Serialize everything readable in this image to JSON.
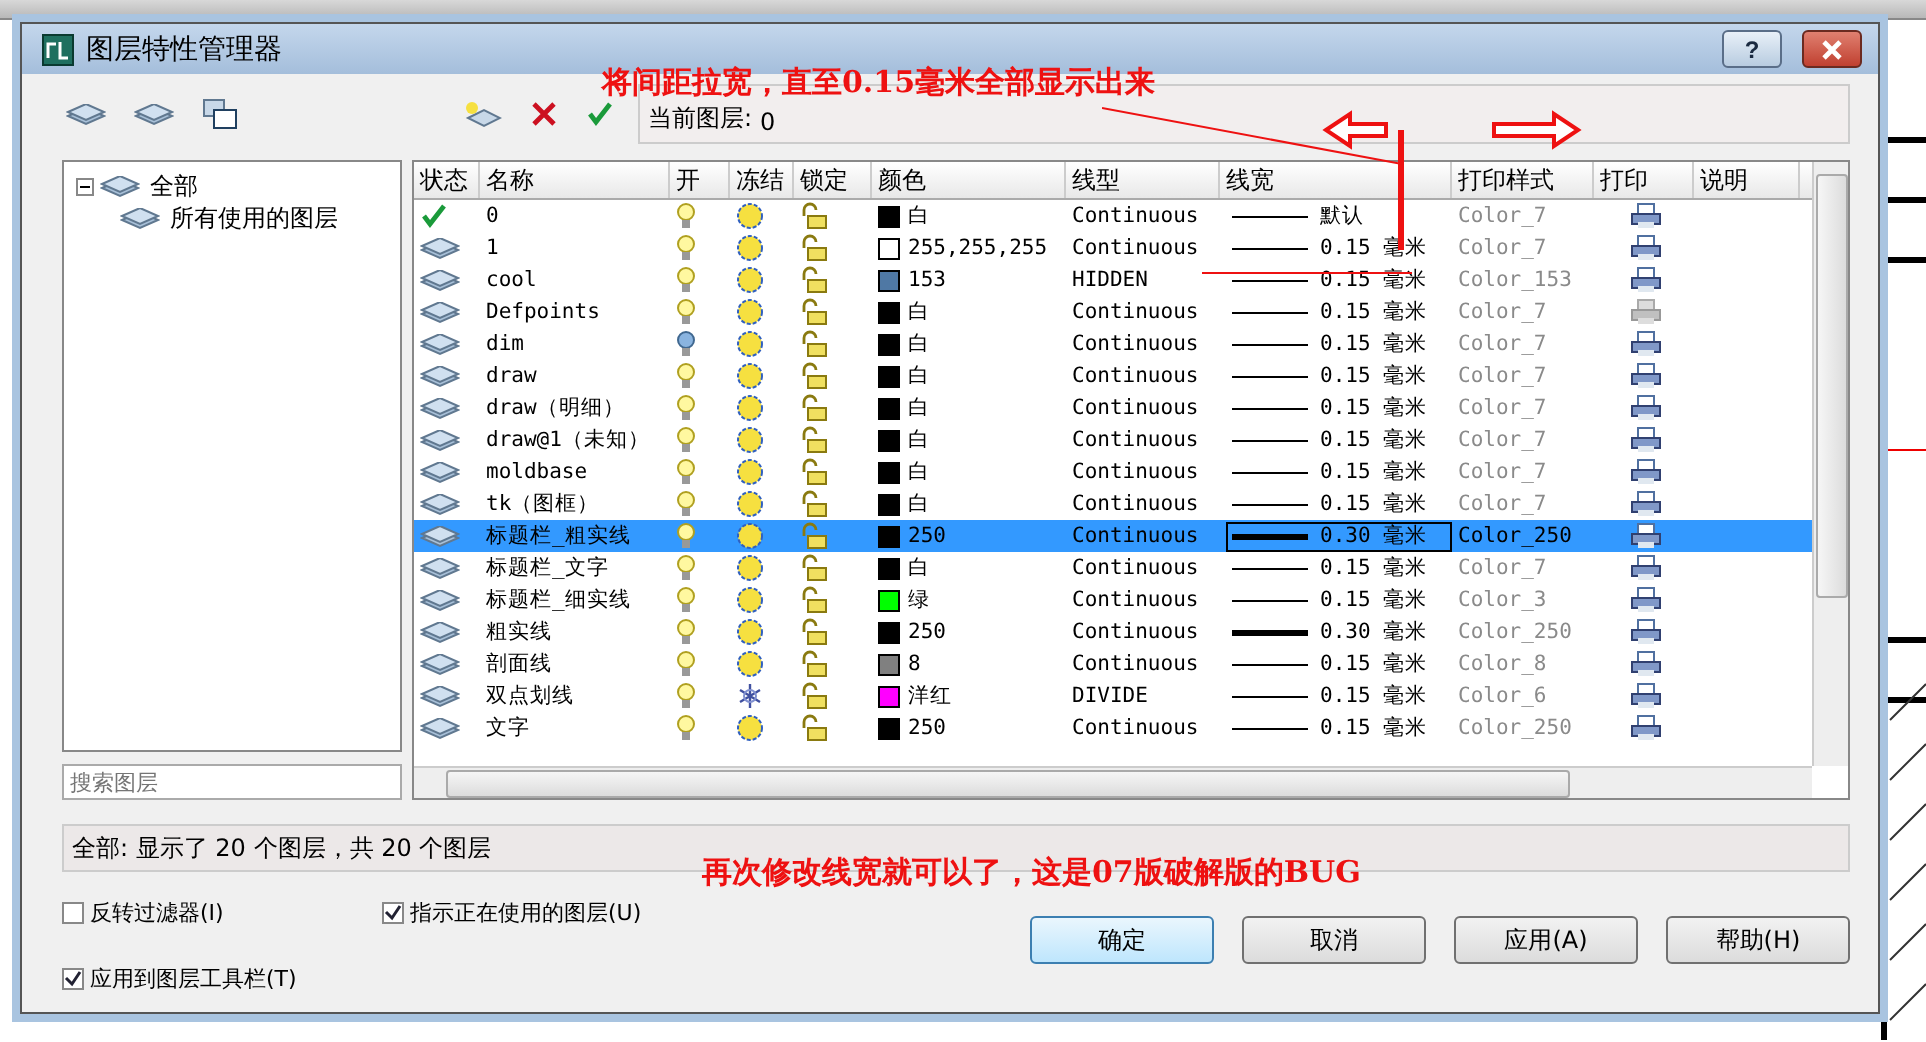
{
  "window": {
    "title": "图层特性管理器",
    "help_button": "?"
  },
  "current_layer": {
    "label": "当前图层:",
    "value": "0"
  },
  "annotations": {
    "top": "将间距拉宽，直至0.15毫米全部显示出来",
    "bottom": "再次修改线宽就可以了，这是07版破解版的BUG"
  },
  "tree": [
    {
      "label": "全部",
      "expanded": true,
      "children": [
        {
          "label": "所有使用的图层"
        }
      ]
    }
  ],
  "search": {
    "placeholder": "搜索图层"
  },
  "table": {
    "columns": [
      "状态",
      "名称",
      "开",
      "冻结",
      "锁定",
      "颜色",
      "线型",
      "线宽",
      "打印样式",
      "打印",
      "说明"
    ],
    "rows": [
      {
        "current": true,
        "name": "0",
        "on": true,
        "frozen": false,
        "locked": false,
        "color": "#000000",
        "color_name": "白",
        "linetype": "Continuous",
        "lineweight": "默认",
        "thick": false,
        "plot_style": "Color_7",
        "plot": true,
        "selected": false
      },
      {
        "current": false,
        "name": "1",
        "on": true,
        "frozen": false,
        "locked": false,
        "color": "#ffffff",
        "color_name": "255,255,255",
        "linetype": "Continuous",
        "lineweight": "0.15 毫米",
        "thick": false,
        "plot_style": "Color_7",
        "plot": true,
        "selected": false
      },
      {
        "current": false,
        "name": "cool",
        "on": true,
        "frozen": false,
        "locked": false,
        "color": "#4f78a4",
        "color_name": "153",
        "linetype": "HIDDEN",
        "lineweight": "0.15 毫米",
        "thick": false,
        "plot_style": "Color_153",
        "plot": true,
        "selected": false
      },
      {
        "current": false,
        "name": "Defpoints",
        "on": true,
        "frozen": false,
        "locked": false,
        "color": "#000000",
        "color_name": "白",
        "linetype": "Continuous",
        "lineweight": "0.15 毫米",
        "thick": false,
        "plot_style": "Color_7",
        "plot": false,
        "selected": false
      },
      {
        "current": false,
        "name": "dim",
        "on": false,
        "frozen": false,
        "locked": false,
        "color": "#000000",
        "color_name": "白",
        "linetype": "Continuous",
        "lineweight": "0.15 毫米",
        "thick": false,
        "plot_style": "Color_7",
        "plot": true,
        "selected": false
      },
      {
        "current": false,
        "name": "draw",
        "on": true,
        "frozen": false,
        "locked": false,
        "color": "#000000",
        "color_name": "白",
        "linetype": "Continuous",
        "lineweight": "0.15 毫米",
        "thick": false,
        "plot_style": "Color_7",
        "plot": true,
        "selected": false
      },
      {
        "current": false,
        "name": "draw（明细）",
        "on": true,
        "frozen": false,
        "locked": false,
        "color": "#000000",
        "color_name": "白",
        "linetype": "Continuous",
        "lineweight": "0.15 毫米",
        "thick": false,
        "plot_style": "Color_7",
        "plot": true,
        "selected": false
      },
      {
        "current": false,
        "name": "draw@1（未知）",
        "on": true,
        "frozen": false,
        "locked": false,
        "color": "#000000",
        "color_name": "白",
        "linetype": "Continuous",
        "lineweight": "0.15 毫米",
        "thick": false,
        "plot_style": "Color_7",
        "plot": true,
        "selected": false
      },
      {
        "current": false,
        "name": "moldbase",
        "on": true,
        "frozen": false,
        "locked": false,
        "color": "#000000",
        "color_name": "白",
        "linetype": "Continuous",
        "lineweight": "0.15 毫米",
        "thick": false,
        "plot_style": "Color_7",
        "plot": true,
        "selected": false
      },
      {
        "current": false,
        "name": "tk（图框）",
        "on": true,
        "frozen": false,
        "locked": false,
        "color": "#000000",
        "color_name": "白",
        "linetype": "Continuous",
        "lineweight": "0.15 毫米",
        "thick": false,
        "plot_style": "Color_7",
        "plot": true,
        "selected": false
      },
      {
        "current": false,
        "name": "标题栏_粗实线",
        "on": true,
        "frozen": false,
        "locked": false,
        "color": "#000000",
        "color_name": "250",
        "linetype": "Continuous",
        "lineweight": "0.30 毫米",
        "thick": true,
        "plot_style": "Color_250",
        "plot": true,
        "selected": true
      },
      {
        "current": false,
        "name": "标题栏_文字",
        "on": true,
        "frozen": false,
        "locked": false,
        "color": "#000000",
        "color_name": "白",
        "linetype": "Continuous",
        "lineweight": "0.15 毫米",
        "thick": false,
        "plot_style": "Color_7",
        "plot": true,
        "selected": false
      },
      {
        "current": false,
        "name": "标题栏_细实线",
        "on": true,
        "frozen": false,
        "locked": false,
        "color": "#00ff00",
        "color_name": "绿",
        "linetype": "Continuous",
        "lineweight": "0.15 毫米",
        "thick": false,
        "plot_style": "Color_3",
        "plot": true,
        "selected": false
      },
      {
        "current": false,
        "name": "粗实线",
        "on": true,
        "frozen": false,
        "locked": false,
        "color": "#000000",
        "color_name": "250",
        "linetype": "Continuous",
        "lineweight": "0.30 毫米",
        "thick": true,
        "plot_style": "Color_250",
        "plot": true,
        "selected": false
      },
      {
        "current": false,
        "name": "剖面线",
        "on": true,
        "frozen": false,
        "locked": false,
        "color": "#808080",
        "color_name": "8",
        "linetype": "Continuous",
        "lineweight": "0.15 毫米",
        "thick": false,
        "plot_style": "Color_8",
        "plot": true,
        "selected": false
      },
      {
        "current": false,
        "name": "双点划线",
        "on": true,
        "frozen": true,
        "locked": false,
        "color": "#ff00ff",
        "color_name": "洋红",
        "linetype": "DIVIDE",
        "lineweight": "0.15 毫米",
        "thick": false,
        "plot_style": "Color_6",
        "plot": true,
        "selected": false
      },
      {
        "current": false,
        "name": "文字",
        "on": true,
        "frozen": false,
        "locked": false,
        "color": "#000000",
        "color_name": "250",
        "linetype": "Continuous",
        "lineweight": "0.15 毫米",
        "thick": false,
        "plot_style": "Color_250",
        "plot": true,
        "selected": false
      }
    ]
  },
  "status_bar": "全部: 显示了 20 个图层，共 20 个图层",
  "options": [
    {
      "label": "反转过滤器(I)",
      "checked": false
    },
    {
      "label": "指示正在使用的图层(U)",
      "checked": true
    },
    {
      "label": "应用到图层工具栏(T)",
      "checked": true
    }
  ],
  "buttons": [
    {
      "label": "确定",
      "default": true
    },
    {
      "label": "取消",
      "default": false
    },
    {
      "label": "应用(A)",
      "default": false
    },
    {
      "label": "帮助(H)",
      "default": false
    }
  ]
}
